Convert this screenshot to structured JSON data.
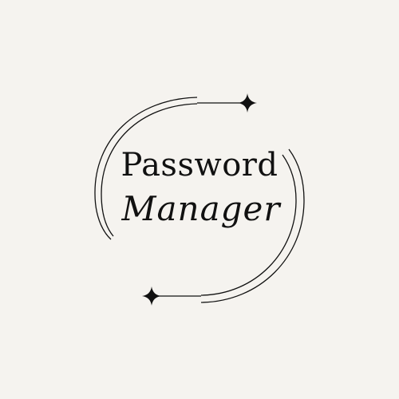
{
  "logo": {
    "line1": "Password",
    "line2": "Manager",
    "ink_color": "#111111",
    "background_color": "#f5f3ef",
    "ornaments": [
      "sparkle-star-icon",
      "sparkle-star-icon"
    ]
  }
}
